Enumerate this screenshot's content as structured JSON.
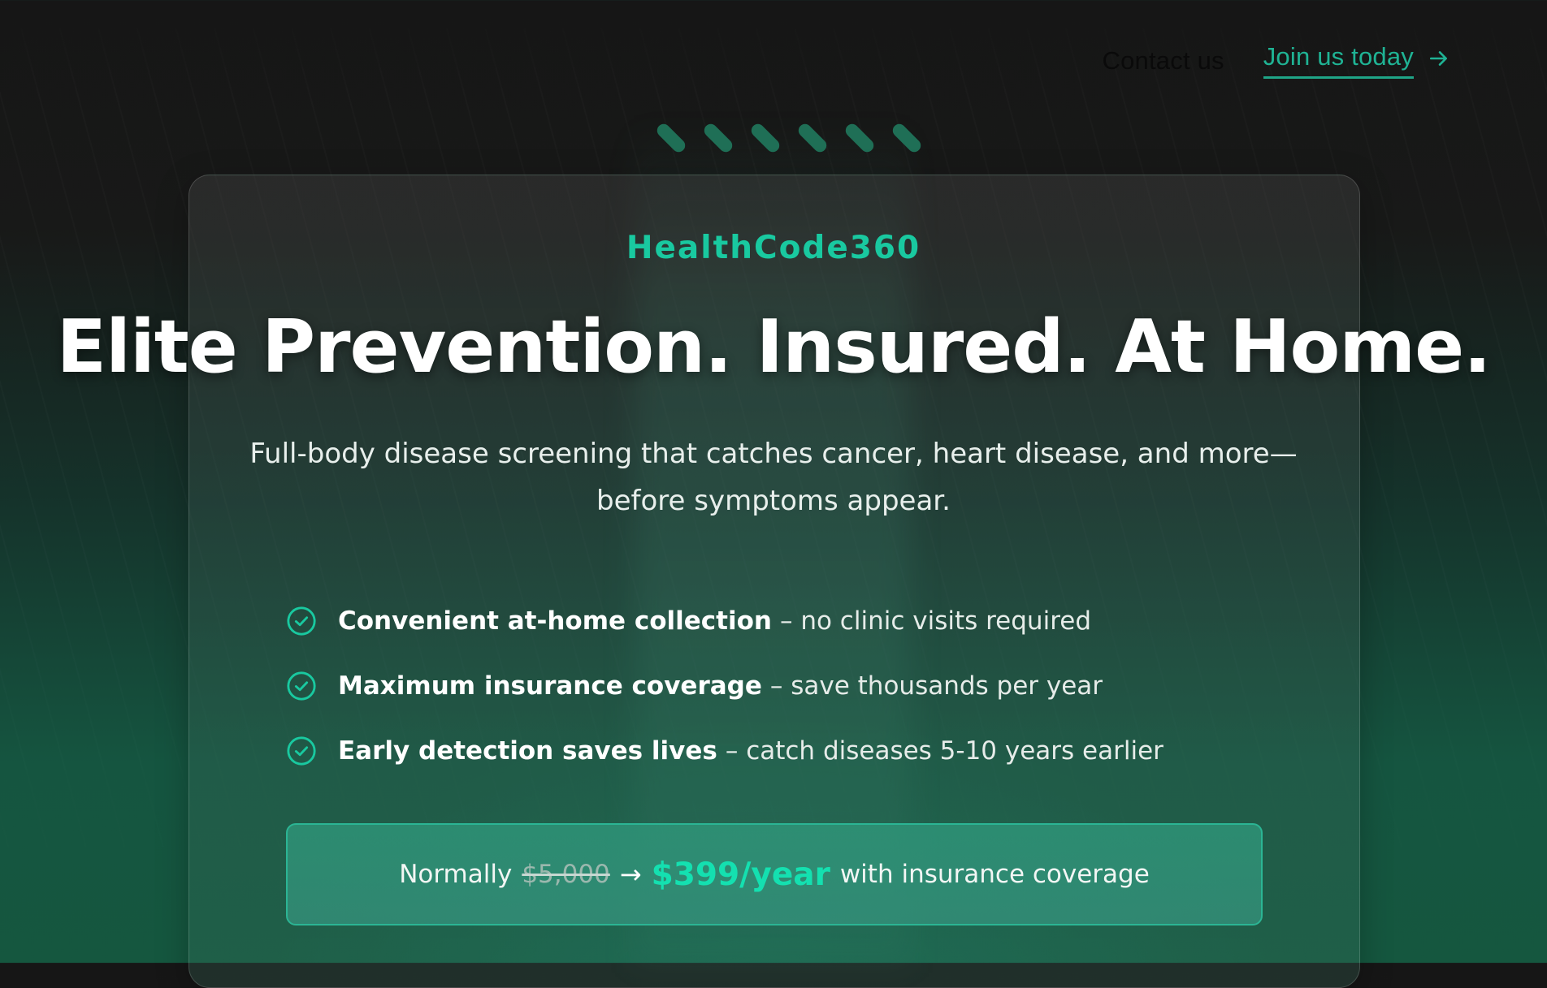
{
  "nav": {
    "contact_label": "Contact us",
    "join_label": "Join us today",
    "join_icon": "arrow-right-icon"
  },
  "hero": {
    "brand": "HealthCode360",
    "headline": "Elite Prevention. Insured. At Home.",
    "subheadline": "Full-body disease screening that catches cancer, heart disease, and more—before symptoms appear."
  },
  "features": [
    {
      "icon": "check-circle-icon",
      "bold": "Convenient at-home collection",
      "rest": "– no clinic visits required"
    },
    {
      "icon": "check-circle-icon",
      "bold": "Maximum insurance coverage",
      "rest": "– save thousands per year"
    },
    {
      "icon": "check-circle-icon",
      "bold": "Early detection saves lives",
      "rest": "– catch diseases 5-10 years earlier"
    }
  ],
  "pricing": {
    "prefix": "Normally",
    "old_price": "$5,000",
    "arrow": "→",
    "new_price": "$399/year",
    "suffix": "with insurance coverage"
  },
  "colors": {
    "accent": "#19c9a0",
    "accent_bright": "#14e0b0",
    "link": "#1fb394",
    "background_top": "#161616",
    "background_bottom": "#15573f"
  }
}
